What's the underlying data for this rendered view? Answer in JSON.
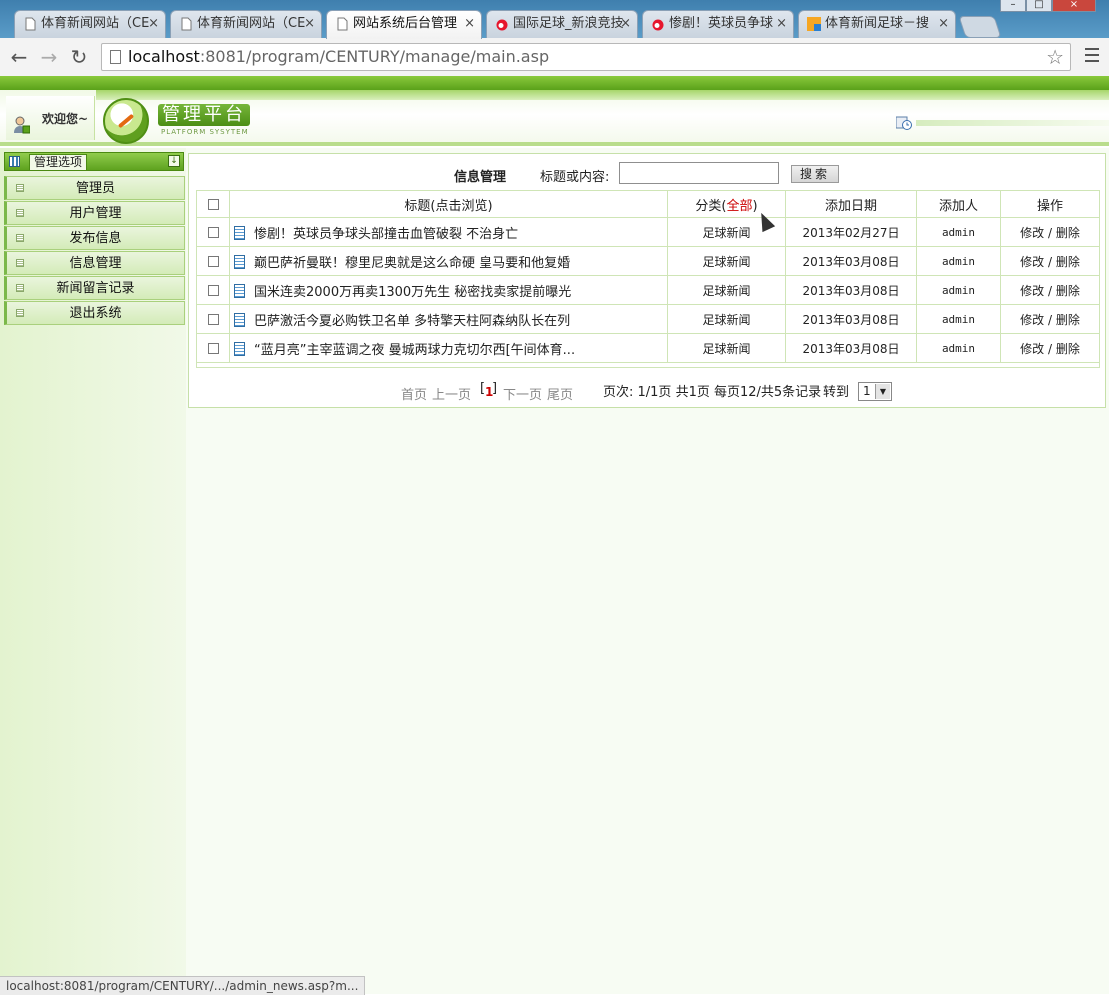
{
  "browser": {
    "tabs": [
      {
        "label": "体育新闻网站（CE",
        "active": false
      },
      {
        "label": "体育新闻网站（CE",
        "active": false
      },
      {
        "label": "网站系统后台管理",
        "active": true
      },
      {
        "label": "国际足球_新浪竞技",
        "active": false
      },
      {
        "label": "惨剧！英球员争球",
        "active": false
      },
      {
        "label": "体育新闻足球－搜",
        "active": false
      }
    ],
    "close_glyph": "×",
    "url_host": "localhost",
    "url_rest": ":8081/program/CENTURY/manage/main.asp",
    "status_url": "localhost:8081/program/CENTURY/.../admin_news.asp?m...",
    "icons": [
      "page-icon",
      "weibo-icon",
      "soku-icon",
      "back-icon",
      "forward-icon",
      "reload-icon",
      "star-icon",
      "menu-icon"
    ]
  },
  "header": {
    "welcome": "欢迎您~",
    "platform_title": "管理平台",
    "platform_subtitle": "PLATFORM SYSYTEM",
    "brand_color": "#5aa11a"
  },
  "sidebar": {
    "title": "管理选项",
    "items": [
      {
        "label": "管理员"
      },
      {
        "label": "用户管理"
      },
      {
        "label": "发布信息"
      },
      {
        "label": "信息管理"
      },
      {
        "label": "新闻留言记录"
      },
      {
        "label": "退出系统"
      }
    ]
  },
  "search": {
    "title": "信息管理",
    "label": "标题或内容:",
    "value": "",
    "button": "搜索"
  },
  "table": {
    "headers": {
      "title": "标题(点击浏览)",
      "category_prefix": "分类(",
      "category_all": "全部",
      "category_suffix": ")",
      "date": "添加日期",
      "author": "添加人",
      "actions": "操作"
    },
    "edit_label": "修改",
    "sep": " / ",
    "delete_label": "删除",
    "rows": [
      {
        "title": "惨剧！英球员争球头部撞击血管破裂 不治身亡",
        "category": "足球新闻",
        "date": "2013年02月27日",
        "author": "admin"
      },
      {
        "title": "巅巴萨祈曼联！穆里尼奥就是这么命硬 皇马要和他复婚",
        "category": "足球新闻",
        "date": "2013年03月08日",
        "author": "admin"
      },
      {
        "title": "国米连卖2000万再卖1300万先生 秘密找卖家提前曝光",
        "category": "足球新闻",
        "date": "2013年03月08日",
        "author": "admin"
      },
      {
        "title": "巴萨激活今夏必购铁卫名单 多特擎天柱阿森纳队长在列",
        "category": "足球新闻",
        "date": "2013年03月08日",
        "author": "admin"
      },
      {
        "title": "“蓝月亮”主宰蓝调之夜 曼城两球力克切尔西[午间体育...",
        "category": "足球新闻",
        "date": "2013年03月08日",
        "author": "admin"
      }
    ]
  },
  "pager": {
    "first": "首页",
    "prev": "上一页",
    "current": "1",
    "next": "下一页",
    "last": "尾页",
    "info": "页次: 1/1页 共1页 每页12/共5条记录",
    "goto_label": "转到",
    "goto_value": "1"
  }
}
